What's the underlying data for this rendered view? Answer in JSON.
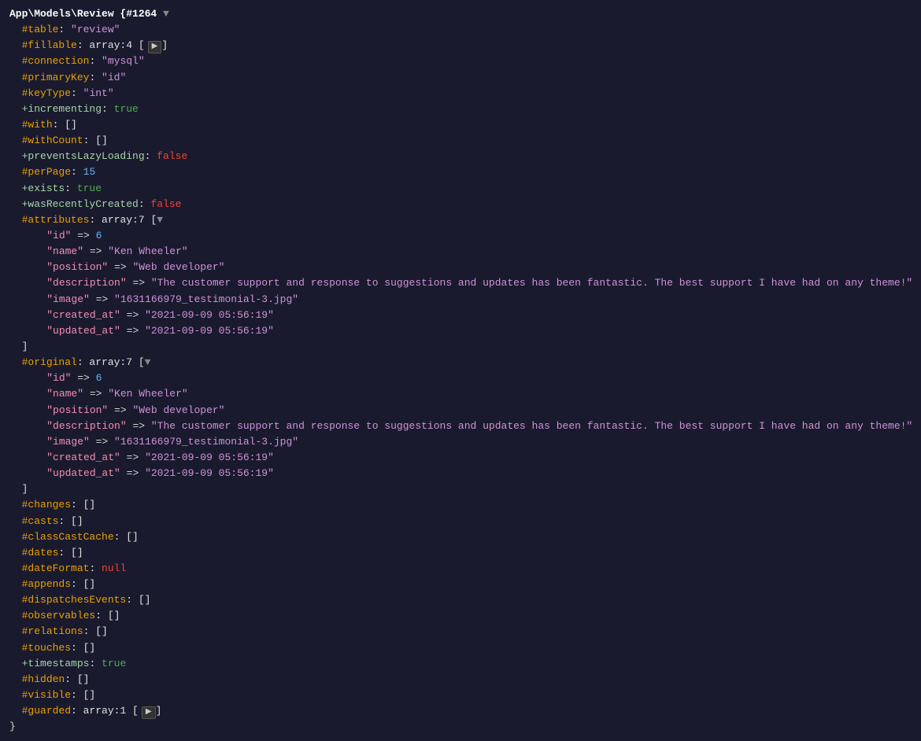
{
  "header": {
    "title": "App\\Models\\Review {#1264 ▼"
  },
  "lines": [
    {
      "type": "header",
      "text": "App\\Models\\Review {#1264 ▼"
    },
    {
      "type": "prop-hash",
      "prefix": "#",
      "name": "table",
      "sep": ": ",
      "val_type": "string",
      "val": "\"review\""
    },
    {
      "type": "prop-hash-expand",
      "prefix": "#",
      "name": "fillable",
      "sep": ": ",
      "val": "array:4 [",
      "btn": "▶"
    },
    {
      "type": "prop-hash",
      "prefix": "#",
      "name": "connection",
      "sep": ": ",
      "val_type": "string",
      "val": "\"mysql\""
    },
    {
      "type": "prop-hash",
      "prefix": "#",
      "name": "primaryKey",
      "sep": ": ",
      "val_type": "string",
      "val": "\"id\""
    },
    {
      "type": "prop-hash",
      "prefix": "#",
      "name": "keyType",
      "sep": ": ",
      "val_type": "string",
      "val": "\"int\""
    },
    {
      "type": "prop-plus",
      "prefix": "+",
      "name": "incrementing",
      "sep": ": ",
      "val_type": "bool-true",
      "val": "true"
    },
    {
      "type": "prop-hash",
      "prefix": "#",
      "name": "with",
      "sep": ": ",
      "val_type": "bracket",
      "val": "[]"
    },
    {
      "type": "prop-hash",
      "prefix": "#",
      "name": "withCount",
      "sep": ": ",
      "val_type": "bracket",
      "val": "[]"
    },
    {
      "type": "prop-plus",
      "prefix": "+",
      "name": "preventsLazyLoading",
      "sep": ": ",
      "val_type": "bool-false",
      "val": "false"
    },
    {
      "type": "prop-hash",
      "prefix": "#",
      "name": "perPage",
      "sep": ": ",
      "val_type": "num",
      "val": "15"
    },
    {
      "type": "prop-plus",
      "prefix": "+",
      "name": "exists",
      "sep": ": ",
      "val_type": "bool-true",
      "val": "true"
    },
    {
      "type": "prop-plus",
      "prefix": "+",
      "name": "wasRecentlyCreated",
      "sep": ": ",
      "val_type": "bool-false",
      "val": "false"
    },
    {
      "type": "prop-hash-expand-down",
      "prefix": "#",
      "name": "attributes",
      "sep": ": ",
      "val": "array:7 [▼"
    },
    {
      "type": "attr-row",
      "key": "\"id\"",
      "arrow": "=>",
      "val": "6"
    },
    {
      "type": "attr-row",
      "key": "\"name\"",
      "arrow": "=>",
      "val": "\"Ken Wheeler\""
    },
    {
      "type": "attr-row",
      "key": "\"position\"",
      "arrow": "=>",
      "val": "\"Web developer\""
    },
    {
      "type": "attr-row-long",
      "key": "\"description\"",
      "arrow": "=>",
      "val": "\"The customer support and response to suggestions and updates has been fantastic. The best support I have had on any theme!\""
    },
    {
      "type": "attr-row",
      "key": "\"image\"",
      "arrow": "=>",
      "val": "\"1631166979_testimonial-3.jpg\""
    },
    {
      "type": "attr-row",
      "key": "\"created_at\"",
      "arrow": "=>",
      "val": "\"2021-09-09 05:56:19\""
    },
    {
      "type": "attr-row",
      "key": "\"updated_at\"",
      "arrow": "=>",
      "val": "\"2021-09-09 05:56:19\""
    },
    {
      "type": "close-bracket"
    },
    {
      "type": "prop-hash-expand-down",
      "prefix": "#",
      "name": "original",
      "sep": ": ",
      "val": "array:7 [▼"
    },
    {
      "type": "attr-row",
      "key": "\"id\"",
      "arrow": "=>",
      "val": "6"
    },
    {
      "type": "attr-row",
      "key": "\"name\"",
      "arrow": "=>",
      "val": "\"Ken Wheeler\""
    },
    {
      "type": "attr-row",
      "key": "\"position\"",
      "arrow": "=>",
      "val": "\"Web developer\""
    },
    {
      "type": "attr-row-long",
      "key": "\"description\"",
      "arrow": "=>",
      "val": "\"The customer support and response to suggestions and updates has been fantastic. The best support I have had on any theme!\""
    },
    {
      "type": "attr-row",
      "key": "\"image\"",
      "arrow": "=>",
      "val": "\"1631166979_testimonial-3.jpg\""
    },
    {
      "type": "attr-row",
      "key": "\"created_at\"",
      "arrow": "=>",
      "val": "\"2021-09-09 05:56:19\""
    },
    {
      "type": "attr-row",
      "key": "\"updated_at\"",
      "arrow": "=>",
      "val": "\"2021-09-09 05:56:19\""
    },
    {
      "type": "close-bracket"
    },
    {
      "type": "prop-hash",
      "prefix": "#",
      "name": "changes",
      "sep": ": ",
      "val_type": "bracket",
      "val": "[]"
    },
    {
      "type": "prop-hash",
      "prefix": "#",
      "name": "casts",
      "sep": ": ",
      "val_type": "bracket",
      "val": "[]"
    },
    {
      "type": "prop-hash",
      "prefix": "#",
      "name": "classCastCache",
      "sep": ": ",
      "val_type": "bracket",
      "val": "[]"
    },
    {
      "type": "prop-hash",
      "prefix": "#",
      "name": "dates",
      "sep": ": ",
      "val_type": "bracket",
      "val": "[]"
    },
    {
      "type": "prop-hash",
      "prefix": "#",
      "name": "dateFormat",
      "sep": ": ",
      "val_type": "null",
      "val": "null"
    },
    {
      "type": "prop-hash",
      "prefix": "#",
      "name": "appends",
      "sep": ": ",
      "val_type": "bracket",
      "val": "[]"
    },
    {
      "type": "prop-hash",
      "prefix": "#",
      "name": "dispatchesEvents",
      "sep": ": ",
      "val_type": "bracket",
      "val": "[]"
    },
    {
      "type": "prop-hash",
      "prefix": "#",
      "name": "observables",
      "sep": ": ",
      "val_type": "bracket",
      "val": "[]"
    },
    {
      "type": "prop-hash",
      "prefix": "#",
      "name": "relations",
      "sep": ": ",
      "val_type": "bracket",
      "val": "[]"
    },
    {
      "type": "prop-hash",
      "prefix": "#",
      "name": "touches",
      "sep": ": ",
      "val_type": "bracket",
      "val": "[]"
    },
    {
      "type": "prop-plus",
      "prefix": "+",
      "name": "timestamps",
      "sep": ": ",
      "val_type": "bool-true",
      "val": "true"
    },
    {
      "type": "prop-hash",
      "prefix": "#",
      "name": "hidden",
      "sep": ": ",
      "val_type": "bracket",
      "val": "[]"
    },
    {
      "type": "prop-hash",
      "prefix": "#",
      "name": "visible",
      "sep": ": ",
      "val_type": "bracket",
      "val": "[]"
    },
    {
      "type": "prop-hash-expand",
      "prefix": "#",
      "name": "guarded",
      "sep": ": ",
      "val": "array:1 [",
      "btn": "▶"
    },
    {
      "type": "final-close"
    }
  ],
  "colors": {
    "background": "#1a1a2e",
    "hash_prop": "#e8a000",
    "plus_prop": "#a5d6a7",
    "string_val": "#ce93d8",
    "bool_true": "#4caf50",
    "bool_false": "#f44336",
    "num_val": "#64b5f6",
    "key_str": "#f48fb1",
    "header": "#ffffff",
    "bracket": "#d4d4d4",
    "null_val": "#f44336"
  }
}
